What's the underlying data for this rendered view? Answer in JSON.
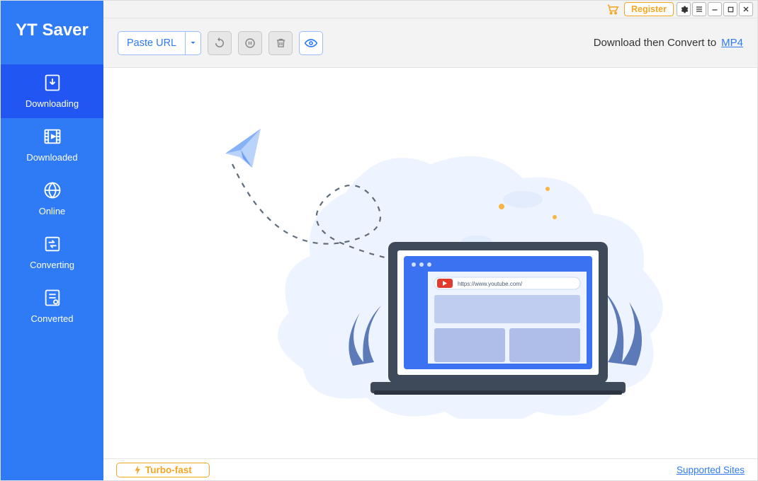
{
  "app": {
    "name": "YT Saver"
  },
  "titlebar": {
    "register": "Register"
  },
  "toolbar": {
    "paste_url": "Paste URL",
    "download_then": "Download then Convert to",
    "format": "MP4"
  },
  "sidebar": {
    "items": [
      {
        "label": "Downloading"
      },
      {
        "label": "Downloaded"
      },
      {
        "label": "Online"
      },
      {
        "label": "Converting"
      },
      {
        "label": "Converted"
      }
    ]
  },
  "illustration": {
    "url_text": "https://www.youtube.com/"
  },
  "footer": {
    "turbo": "Turbo-fast",
    "supported": "Supported Sites"
  }
}
